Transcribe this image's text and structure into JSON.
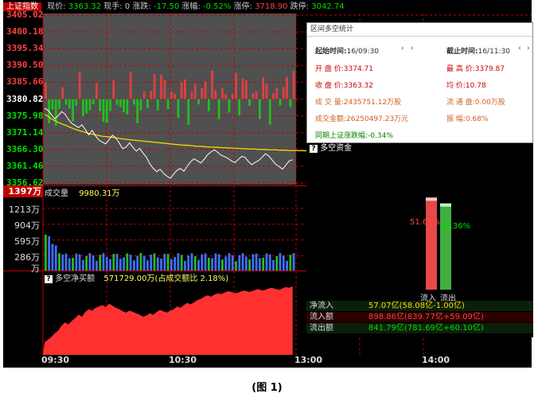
{
  "top_bar": {
    "index_name": "上证指数",
    "price_label": "现价:",
    "price": "3363.32",
    "hand_label": "现手:",
    "hand": "0",
    "change_label": "涨跌:",
    "change": "-17.50",
    "pct_label": "涨幅:",
    "pct": "-0.52%",
    "limit_up_label": "涨停:",
    "limit_up": "3718.90",
    "limit_down_label": "跌停:",
    "limit_down": "3042.74"
  },
  "price_axis": [
    "3405.02",
    "3400.18",
    "3395.34",
    "3390.50",
    "3385.66",
    "3380.82",
    "3375.98",
    "3371.14",
    "3366.30",
    "3361.46",
    "3356.62"
  ],
  "volume": {
    "badge": "1397万",
    "label": "成交量",
    "value": "9980.31万",
    "axis": [
      "1213万",
      "904万",
      "595万",
      "286万",
      "万"
    ]
  },
  "net_buy": {
    "label": "多空净买额",
    "value": "571729.00万(占成交额比 2.18%)"
  },
  "time_axis": [
    "09:30",
    "10:30",
    "13:00",
    "14:00"
  ],
  "stats": {
    "title": "区间多空统计",
    "start_label": "起始时间:",
    "start": "16/09:30",
    "end_label": "截止时间:",
    "end": "16/11:30",
    "open_label": "开 盘 价:",
    "open": "3374.71",
    "high_label": "最 高 价:",
    "high": "3379.87",
    "close_label": "收 盘 价:",
    "close": "3363.32",
    "avg_label": "均    价:",
    "avg": "10.78",
    "vol_label": "成 交 量:",
    "vol": "2435751.12万股",
    "float_label": "流 通 盘:",
    "float": "0.00万股",
    "amount_label": "成交金额:",
    "amount": "26250497.23万元",
    "amp_label": "振    幅:",
    "amp": "0.68%",
    "same_period": "同期上证涨跌幅:-0.34%"
  },
  "fund": {
    "title": "多空资金",
    "inflow_pct": "51.64%",
    "outflow_pct": "48.36%",
    "inflow_label": "流入",
    "outflow_label": "流出",
    "rows": [
      {
        "label": "净流入",
        "value": "57.07亿(58.08亿-1.00亿)"
      },
      {
        "label": "流入额",
        "value": "898.86亿(839.77亿+59.09亿)"
      },
      {
        "label": "流出额",
        "value": "841.79亿(781.69亿+60.10亿)"
      }
    ]
  },
  "caption": "(图 1)",
  "chart_data": {
    "type": "line",
    "y_range": [
      3356.62,
      3405.02
    ],
    "prev_close": 3380.82,
    "price": [
      3378.2,
      3377.6,
      3376.4,
      3375.1,
      3376.0,
      3377.2,
      3376.5,
      3375.0,
      3373.8,
      3373.2,
      3372.6,
      3373.4,
      3372.0,
      3370.5,
      3371.8,
      3370.2,
      3369.0,
      3368.4,
      3367.9,
      3369.2,
      3370.4,
      3369.6,
      3368.1,
      3366.5,
      3367.0,
      3368.2,
      3366.9,
      3365.8,
      3366.6,
      3365.2,
      3364.0,
      3362.1,
      3360.8,
      3359.9,
      3360.6,
      3359.4,
      3358.6,
      3358.0,
      3359.2,
      3360.3,
      3360.8,
      3360.0,
      3361.5,
      3362.8,
      3363.6,
      3363.0,
      3362.4,
      3363.5,
      3364.8,
      3365.6,
      3366.2,
      3365.4,
      3364.6,
      3364.2,
      3363.7,
      3363.0,
      3362.5,
      3363.4,
      3364.3,
      3364.0,
      3362.8,
      3361.9,
      3362.6,
      3363.1,
      3364.0,
      3365.1,
      3364.4,
      3363.2,
      3362.0,
      3361.4,
      3360.6,
      3361.8,
      3363.0,
      3363.32
    ],
    "avg_price": [
      3376.4,
      3375.9,
      3375.1,
      3374.6,
      3374.1,
      3373.7,
      3373.3,
      3372.9,
      3372.5,
      3372.1,
      3371.8,
      3371.5,
      3371.2,
      3370.9,
      3370.7,
      3370.5,
      3370.3,
      3370.1,
      3370.0,
      3369.9,
      3369.8,
      3369.6,
      3369.5,
      3369.3,
      3369.2,
      3369.1,
      3369.0,
      3368.9,
      3368.8,
      3368.7,
      3368.6,
      3368.5,
      3368.4,
      3368.3,
      3368.2,
      3368.1,
      3368.0,
      3367.9,
      3367.8,
      3367.7,
      3367.6,
      3367.5,
      3367.5,
      3367.4,
      3367.3,
      3367.2,
      3367.2,
      3367.1,
      3367.0,
      3367.0,
      3366.9,
      3366.9,
      3366.8,
      3366.8,
      3366.7,
      3366.7,
      3366.6,
      3366.6,
      3366.5,
      3366.5,
      3366.4,
      3366.4,
      3366.4,
      3366.3,
      3366.3,
      3366.3,
      3366.2,
      3366.2,
      3366.2,
      3366.1,
      3366.1,
      3366.1,
      3366.0,
      3366.0
    ],
    "volume_axis": [
      1213,
      904,
      595,
      286
    ],
    "net_buy_share": [
      0.18,
      0.22,
      0.26,
      0.31,
      0.35,
      0.42,
      0.47,
      0.44,
      0.49,
      0.53,
      0.58,
      0.55,
      0.62,
      0.66,
      0.64,
      0.68,
      0.7,
      0.72,
      0.69,
      0.74,
      0.71,
      0.68,
      0.66,
      0.63,
      0.61,
      0.64,
      0.62,
      0.6,
      0.58,
      0.55,
      0.57,
      0.6,
      0.58,
      0.62,
      0.65,
      0.63,
      0.61,
      0.64,
      0.66,
      0.7,
      0.68,
      0.72,
      0.75,
      0.73,
      0.76,
      0.79,
      0.81,
      0.84,
      0.86,
      0.84,
      0.87,
      0.89,
      0.88,
      0.9,
      0.92,
      0.91,
      0.89,
      0.9,
      0.92,
      0.93,
      0.91,
      0.92,
      0.94,
      0.95,
      0.93,
      0.94,
      0.96,
      0.97,
      0.95,
      0.94,
      0.96,
      0.98,
      0.97,
      0.99
    ],
    "fund_split": {
      "inflow": 51.64,
      "outflow": 48.36
    }
  }
}
